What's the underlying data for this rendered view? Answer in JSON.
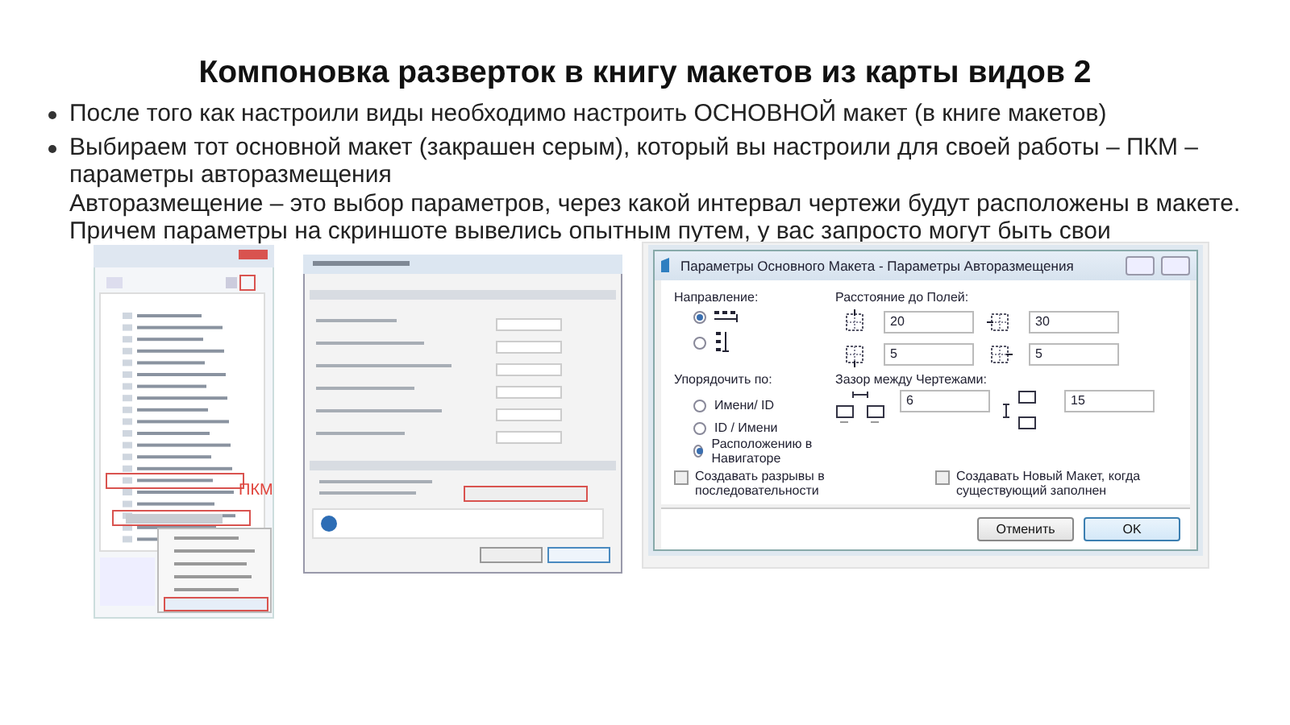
{
  "title": "Компоновка разверток в книгу макетов из карты видов 2",
  "bullets": [
    {
      "paragraphs": [
        "После того как настроили виды необходимо настроить ОСНОВНОЙ макет (в книге макетов)"
      ]
    },
    {
      "paragraphs": [
        "Выбираем тот основной макет (закрашен серым), который вы настроили для своей работы – ПКМ – параметры авторазмещения",
        "Авторазмещение – это выбор параметров, через какой интервал чертежи будут расположены в макете. Причем параметры на скриншоте вывелись опытным путем, у вас запросто могут быть свои"
      ]
    }
  ],
  "navigator_screenshot": {
    "annotation": "ПКМ"
  },
  "autoplace_dialog": {
    "title": "Параметры Основного Макета - Параметры Авторазмещения",
    "direction": {
      "label": "Направление:",
      "options": [
        {
          "kind": "horizontal",
          "selected": true
        },
        {
          "kind": "vertical",
          "selected": false
        }
      ]
    },
    "margins": {
      "label": "Расстояние до Полей:",
      "fields": [
        {
          "kind": "top",
          "value": "20"
        },
        {
          "kind": "left",
          "value": "30"
        },
        {
          "kind": "bottom",
          "value": "5"
        },
        {
          "kind": "right",
          "value": "5"
        }
      ]
    },
    "sort": {
      "label": "Упорядочить по:",
      "options": [
        {
          "label": "Имени/ ID",
          "selected": false
        },
        {
          "label": "ID / Имени",
          "selected": false
        },
        {
          "label": "Расположению в Навигаторе",
          "selected": true
        }
      ]
    },
    "gap": {
      "label": "Зазор между Чертежами:",
      "fields": [
        {
          "kind": "horizontal",
          "value": "6"
        },
        {
          "kind": "vertical",
          "value": "15"
        }
      ]
    },
    "checkboxes": [
      {
        "label": "Создавать разрывы в последовательности",
        "checked": false
      },
      {
        "label": "Создавать Новый Макет, когда существующий заполнен",
        "checked": false
      }
    ],
    "buttons": [
      {
        "label": "Отменить",
        "kind": "default"
      },
      {
        "label": "OK",
        "kind": "primary"
      }
    ]
  }
}
